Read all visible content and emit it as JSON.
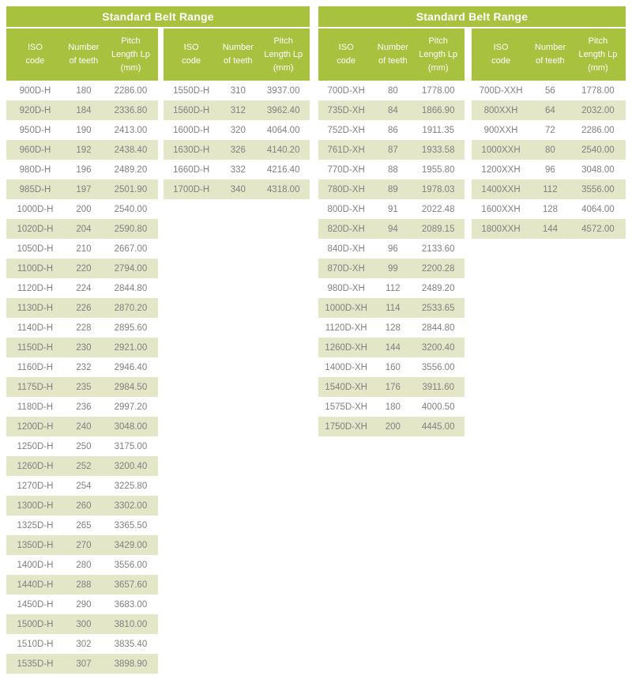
{
  "groups": [
    {
      "title": "Standard Belt Range",
      "subtables": [
        {
          "name": "h-belts-part1",
          "headers": [
            "ISO\ncode",
            "Number\nof teeth",
            "Pitch\nLength Lp\n(mm)"
          ],
          "rows": [
            [
              "900D-H",
              "180",
              "2286.00"
            ],
            [
              "920D-H",
              "184",
              "2336.80"
            ],
            [
              "950D-H",
              "190",
              "2413.00"
            ],
            [
              "960D-H",
              "192",
              "2438.40"
            ],
            [
              "980D-H",
              "196",
              "2489.20"
            ],
            [
              "985D-H",
              "197",
              "2501.90"
            ],
            [
              "1000D-H",
              "200",
              "2540.00"
            ],
            [
              "1020D-H",
              "204",
              "2590.80"
            ],
            [
              "1050D-H",
              "210",
              "2667.00"
            ],
            [
              "1100D-H",
              "220",
              "2794.00"
            ],
            [
              "1120D-H",
              "224",
              "2844.80"
            ],
            [
              "1130D-H",
              "226",
              "2870.20"
            ],
            [
              "1140D-H",
              "228",
              "2895.60"
            ],
            [
              "1150D-H",
              "230",
              "2921.00"
            ],
            [
              "1160D-H",
              "232",
              "2946.40"
            ],
            [
              "1175D-H",
              "235",
              "2984.50"
            ],
            [
              "1180D-H",
              "236",
              "2997.20"
            ],
            [
              "1200D-H",
              "240",
              "3048.00"
            ],
            [
              "1250D-H",
              "250",
              "3175.00"
            ],
            [
              "1260D-H",
              "252",
              "3200.40"
            ],
            [
              "1270D-H",
              "254",
              "3225.80"
            ],
            [
              "1300D-H",
              "260",
              "3302.00"
            ],
            [
              "1325D-H",
              "265",
              "3365.50"
            ],
            [
              "1350D-H",
              "270",
              "3429.00"
            ],
            [
              "1400D-H",
              "280",
              "3556.00"
            ],
            [
              "1440D-H",
              "288",
              "3657.60"
            ],
            [
              "1450D-H",
              "290",
              "3683.00"
            ],
            [
              "1500D-H",
              "300",
              "3810.00"
            ],
            [
              "1510D-H",
              "302",
              "3835.40"
            ],
            [
              "1535D-H",
              "307",
              "3898.90"
            ]
          ]
        },
        {
          "name": "h-belts-part2",
          "headers": [
            "ISO\ncode",
            "Number\nof teeth",
            "Pitch\nLength Lp\n(mm)"
          ],
          "rows": [
            [
              "1550D-H",
              "310",
              "3937.00"
            ],
            [
              "1560D-H",
              "312",
              "3962.40"
            ],
            [
              "1600D-H",
              "320",
              "4064.00"
            ],
            [
              "1630D-H",
              "326",
              "4140.20"
            ],
            [
              "1660D-H",
              "332",
              "4216.40"
            ],
            [
              "1700D-H",
              "340",
              "4318.00"
            ]
          ]
        }
      ]
    },
    {
      "title": "Standard Belt Range",
      "subtables": [
        {
          "name": "xh-belts",
          "headers": [
            "ISO\ncode",
            "Number\nof teeth",
            "Pitch\nLength Lp\n(mm)"
          ],
          "rows": [
            [
              "700D-XH",
              "80",
              "1778.00"
            ],
            [
              "735D-XH",
              "84",
              "1866.90"
            ],
            [
              "752D-XH",
              "86",
              "1911.35"
            ],
            [
              "761D-XH",
              "87",
              "1933.58"
            ],
            [
              "770D-XH",
              "88",
              "1955.80"
            ],
            [
              "780D-XH",
              "89",
              "1978.03"
            ],
            [
              "800D-XH",
              "91",
              "2022.48"
            ],
            [
              "820D-XH",
              "94",
              "2089.15"
            ],
            [
              "840D-XH",
              "96",
              "2133.60"
            ],
            [
              "870D-XH",
              "99",
              "2200.28"
            ],
            [
              "980D-XH",
              "112",
              "2489.20"
            ],
            [
              "1000D-XH",
              "114",
              "2533.65"
            ],
            [
              "1120D-XH",
              "128",
              "2844.80"
            ],
            [
              "1260D-XH",
              "144",
              "3200.40"
            ],
            [
              "1400D-XH",
              "160",
              "3556.00"
            ],
            [
              "1540D-XH",
              "176",
              "3911.60"
            ],
            [
              "1575D-XH",
              "180",
              "4000.50"
            ],
            [
              "1750D-XH",
              "200",
              "4445.00"
            ]
          ]
        },
        {
          "name": "xxh-belts",
          "headers": [
            "ISO\ncode",
            "Number\nof teeth",
            "Pitch\nLength Lp\n(mm)"
          ],
          "rows": [
            [
              "700D-XXH",
              "56",
              "1778.00"
            ],
            [
              "800XXH",
              "64",
              "2032.00"
            ],
            [
              "900XXH",
              "72",
              "2286.00"
            ],
            [
              "1000XXH",
              "80",
              "2540.00"
            ],
            [
              "1200XXH",
              "96",
              "3048.00"
            ],
            [
              "1400XXH",
              "112",
              "3556.00"
            ],
            [
              "1600XXH",
              "128",
              "4064.00"
            ],
            [
              "1800XXH",
              "144",
              "4572.00"
            ]
          ]
        }
      ]
    }
  ],
  "colors": {
    "header_green": "#a8c240",
    "stripe": "#e3e7c8",
    "row_text": "#808080",
    "header_text": "#ffffff",
    "background": "#ffffff"
  }
}
